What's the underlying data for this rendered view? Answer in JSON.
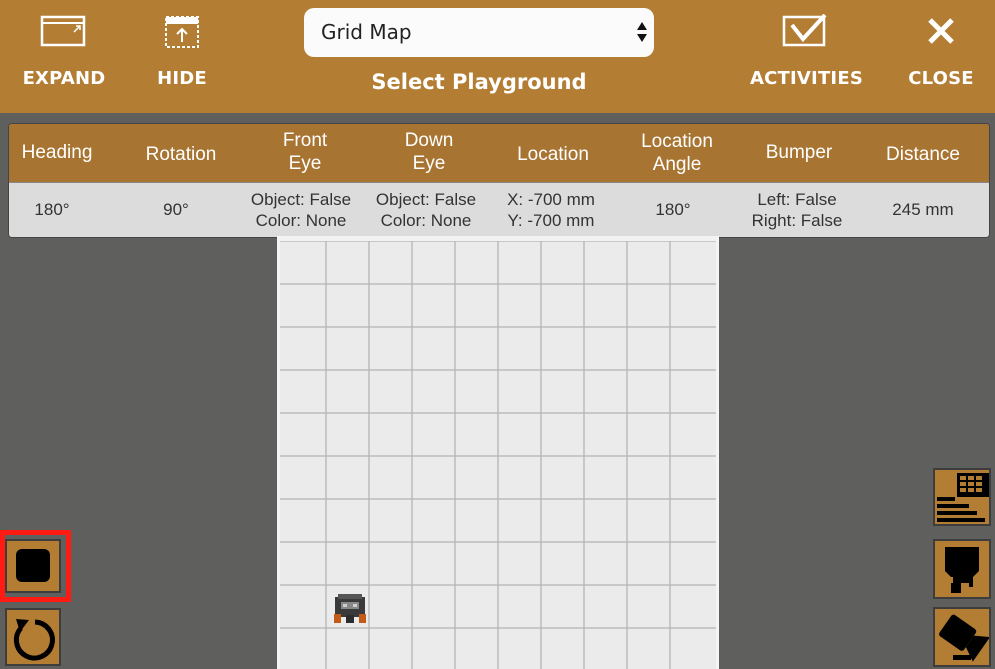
{
  "toolbar": {
    "expand_label": "EXPAND",
    "hide_label": "HIDE",
    "activities_label": "ACTIVITIES",
    "close_label": "CLOSE",
    "playground_select": {
      "value": "Grid Map",
      "caption": "Select Playground"
    }
  },
  "sensor_table": {
    "headers": [
      {
        "line1": "Heading",
        "line2": ""
      },
      {
        "line1": "Rotation",
        "line2": ""
      },
      {
        "line1": "Front",
        "line2": "Eye"
      },
      {
        "line1": "Down",
        "line2": "Eye"
      },
      {
        "line1": "Location",
        "line2": ""
      },
      {
        "line1": "Location",
        "line2": "Angle"
      },
      {
        "line1": "Bumper",
        "line2": ""
      },
      {
        "line1": "Distance",
        "line2": ""
      }
    ],
    "values": [
      {
        "line1": "180°",
        "line2": ""
      },
      {
        "line1": "90°",
        "line2": ""
      },
      {
        "line1": "Object: False",
        "line2": "Color: None"
      },
      {
        "line1": "Object: False",
        "line2": "Color: None"
      },
      {
        "line1": "X: -700 mm",
        "line2": "Y: -700 mm"
      },
      {
        "line1": "180°",
        "line2": ""
      },
      {
        "line1": "Left: False",
        "line2": "Right: False"
      },
      {
        "line1": "245 mm",
        "line2": ""
      }
    ]
  },
  "colors": {
    "toolbar_bg": "#b37d34",
    "header_bg": "#a87432",
    "canvas_bg": "#5f605e",
    "highlight": "#ff1a12"
  },
  "icons": {
    "expand": "expand-window-icon",
    "hide": "hide-panel-icon",
    "activities": "activities-checkbox-icon",
    "close": "close-x-icon",
    "stop": "stop-square-icon",
    "reset": "reset-circular-arrow-icon",
    "data_table": "data-table-icon",
    "robot_view": "robot-view-icon",
    "camera": "camera-icon"
  }
}
